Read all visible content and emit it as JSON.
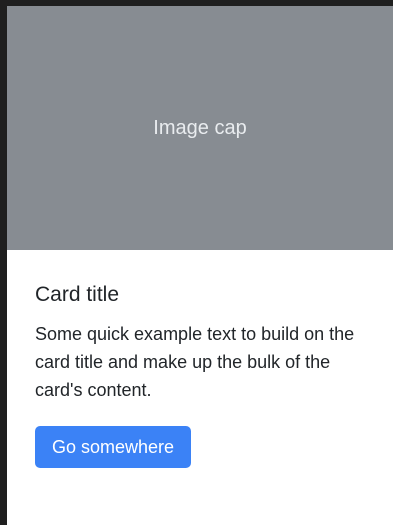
{
  "card": {
    "image_cap_label": "Image cap",
    "title": "Card title",
    "text": "Some quick example text to build on the card title and make up the bulk of the card's content.",
    "button_label": "Go somewhere"
  },
  "colors": {
    "page_background": "#1f1f1f",
    "card_background": "#ffffff",
    "image_cap_background": "#878c92",
    "button_background": "#3b82f6"
  }
}
